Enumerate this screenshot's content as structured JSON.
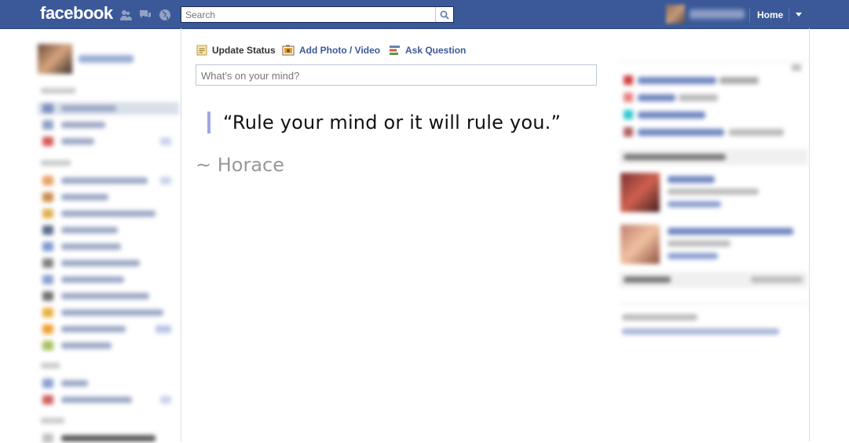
{
  "topbar": {
    "logo": "facebook",
    "search_placeholder": "Search",
    "home_label": "Home",
    "brand_color": "#3b5998"
  },
  "composer": {
    "tabs": [
      {
        "label": "Update Status",
        "icon": "status-icon",
        "active": true
      },
      {
        "label": "Add Photo / Video",
        "icon": "photo-icon",
        "active": false
      },
      {
        "label": "Ask Question",
        "icon": "question-icon",
        "active": false
      }
    ],
    "input_placeholder": "What's on your mind?"
  },
  "quote": {
    "text": "“Rule your mind or it will rule you.”",
    "author": "~ Horace",
    "accent_color": "#a0a6e4"
  }
}
